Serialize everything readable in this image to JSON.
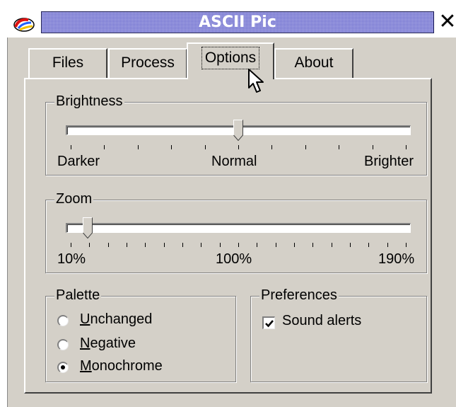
{
  "window": {
    "title": "ASCII Pic",
    "close_icon": "close-icon",
    "app_icon": "paint-palette-icon"
  },
  "tabs": [
    {
      "label": "Files",
      "active": false
    },
    {
      "label": "Process",
      "active": false
    },
    {
      "label": "Options",
      "active": true
    },
    {
      "label": "About",
      "active": false
    }
  ],
  "brightness": {
    "title": "Brightness",
    "value_fraction": 0.5,
    "labels": {
      "min": "Darker",
      "mid": "Normal",
      "max": "Brighter"
    }
  },
  "zoom": {
    "title": "Zoom",
    "value_fraction": 0.05,
    "labels": {
      "min": "10%",
      "mid": "100%",
      "max": "190%"
    }
  },
  "palette": {
    "title": "Palette",
    "options": [
      {
        "access_key": "U",
        "rest": "nchanged",
        "selected": false
      },
      {
        "access_key": "N",
        "rest": "egative",
        "selected": false
      },
      {
        "access_key": "M",
        "rest": "onochrome",
        "selected": true
      }
    ]
  },
  "preferences": {
    "title": "Preferences",
    "sound_alerts": {
      "label": "Sound alerts",
      "checked": true
    }
  },
  "colors": {
    "title_bar": "#6f6fd0",
    "face": "#d4d0c8"
  }
}
